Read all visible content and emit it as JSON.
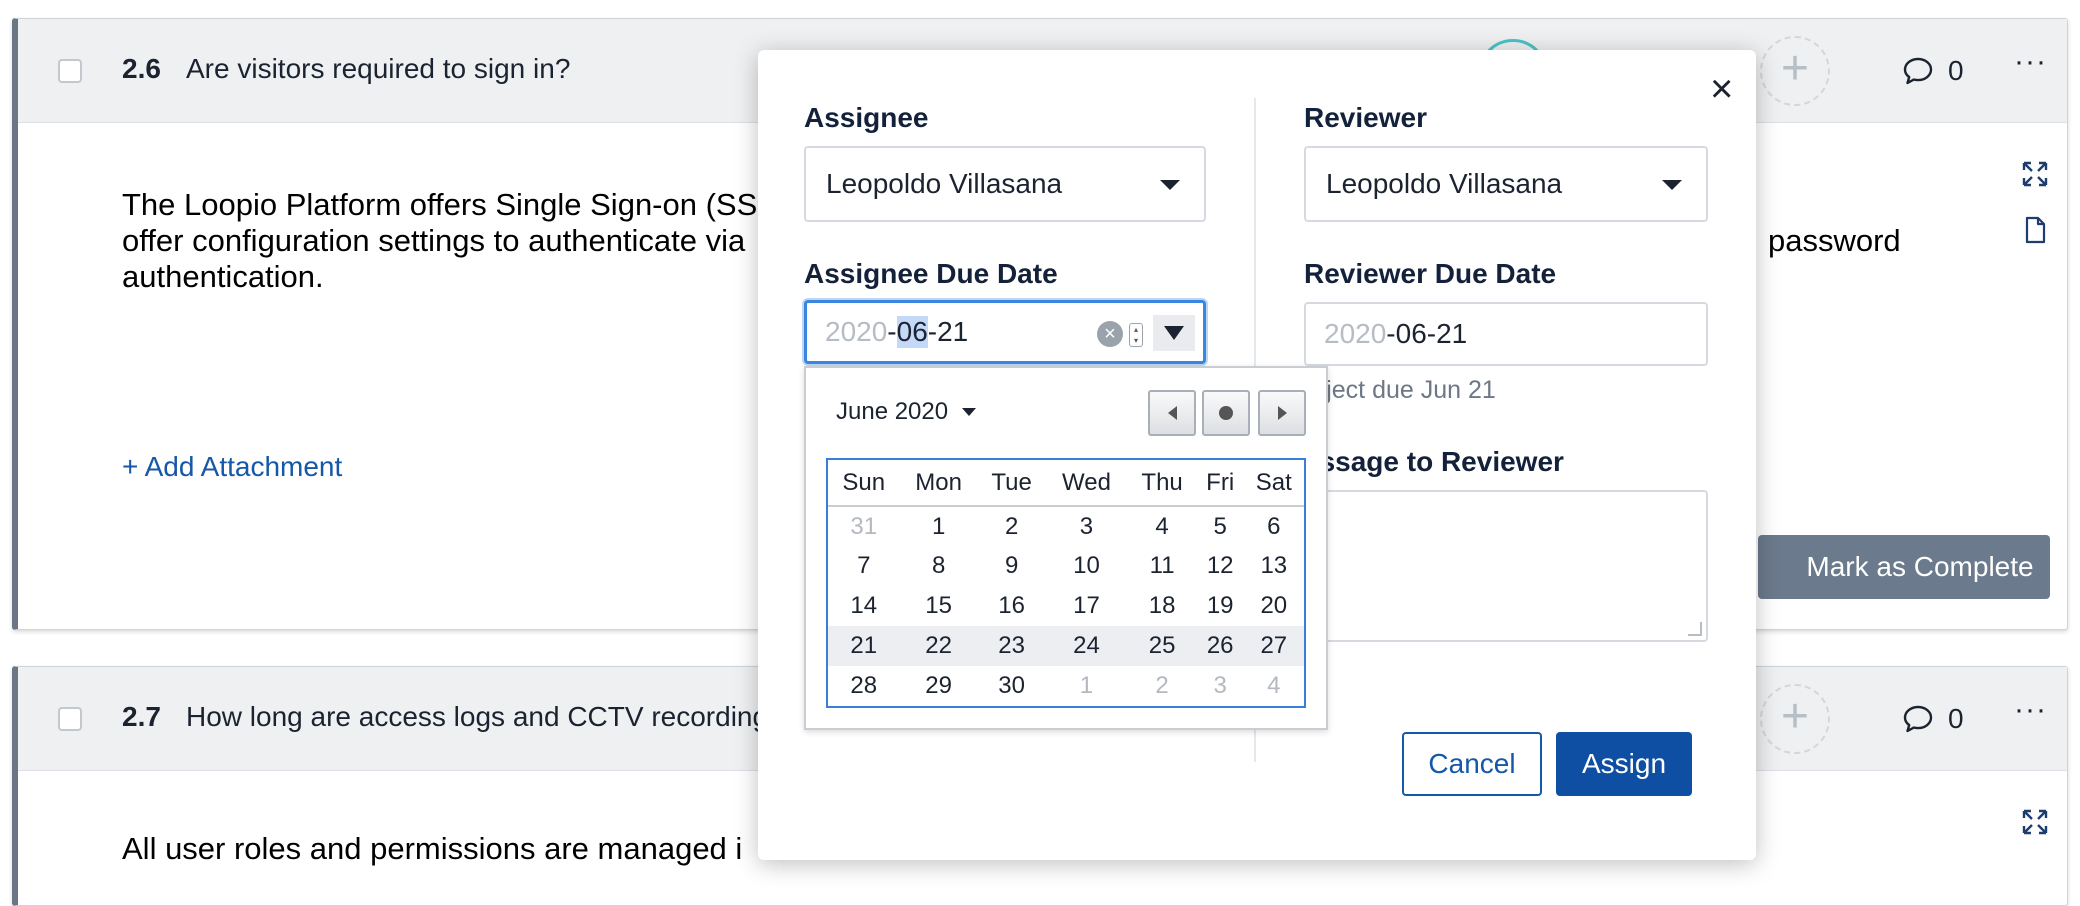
{
  "questions": [
    {
      "number": "2.6",
      "title": "Are visitors required to sign in?",
      "comment_count": "0",
      "answer_line1": "The Loopio Platform offers Single Sign-on (SS",
      "answer_line2": "offer configuration settings to authenticate via",
      "answer_line2_end": "password",
      "answer_line3": "authentication.",
      "add_attachment": "+ Add Attachment",
      "mark_complete": "Mark as Complete"
    },
    {
      "number": "2.7",
      "title": "How long are access logs and CCTV recording",
      "comment_count": "0",
      "answer_line1": "All user roles and permissions are managed i"
    }
  ],
  "modal": {
    "assignee_label": "Assignee",
    "assignee_value": "Leopoldo Villasana",
    "reviewer_label": "Reviewer",
    "reviewer_value": "Leopoldo Villasana",
    "assignee_due_label": "Assignee Due Date",
    "assignee_due_year": "2020",
    "assignee_due_month": "06",
    "assignee_due_day": "21",
    "reviewer_due_label": "Reviewer Due Date",
    "reviewer_due_year": "2020",
    "reviewer_due_rest": "-06-21",
    "project_hint": "roject due Jun 21",
    "message_label": "essage to Reviewer",
    "cancel": "Cancel",
    "assign": "Assign",
    "close": "×"
  },
  "calendar": {
    "month_label": "June 2020",
    "weekdays": [
      "Sun",
      "Mon",
      "Tue",
      "Wed",
      "Thu",
      "Fri",
      "Sat"
    ],
    "weeks": [
      [
        "31",
        "1",
        "2",
        "3",
        "4",
        "5",
        "6"
      ],
      [
        "7",
        "8",
        "9",
        "10",
        "11",
        "12",
        "13"
      ],
      [
        "14",
        "15",
        "16",
        "17",
        "18",
        "19",
        "20"
      ],
      [
        "21",
        "22",
        "23",
        "24",
        "25",
        "26",
        "27"
      ],
      [
        "28",
        "29",
        "30",
        "1",
        "2",
        "3",
        "4"
      ]
    ],
    "selected_day": "21"
  },
  "colors": {
    "primary": "#0f4fa3",
    "focus": "#3a86e0",
    "selected_day": "#b8cff0",
    "mark_complete_bg": "#6b7a8c"
  },
  "icons": {
    "comment": "speech-bubble-icon",
    "more": "ellipsis-icon",
    "expand": "expand-arrows-icon",
    "document": "document-icon",
    "close": "close-icon"
  }
}
